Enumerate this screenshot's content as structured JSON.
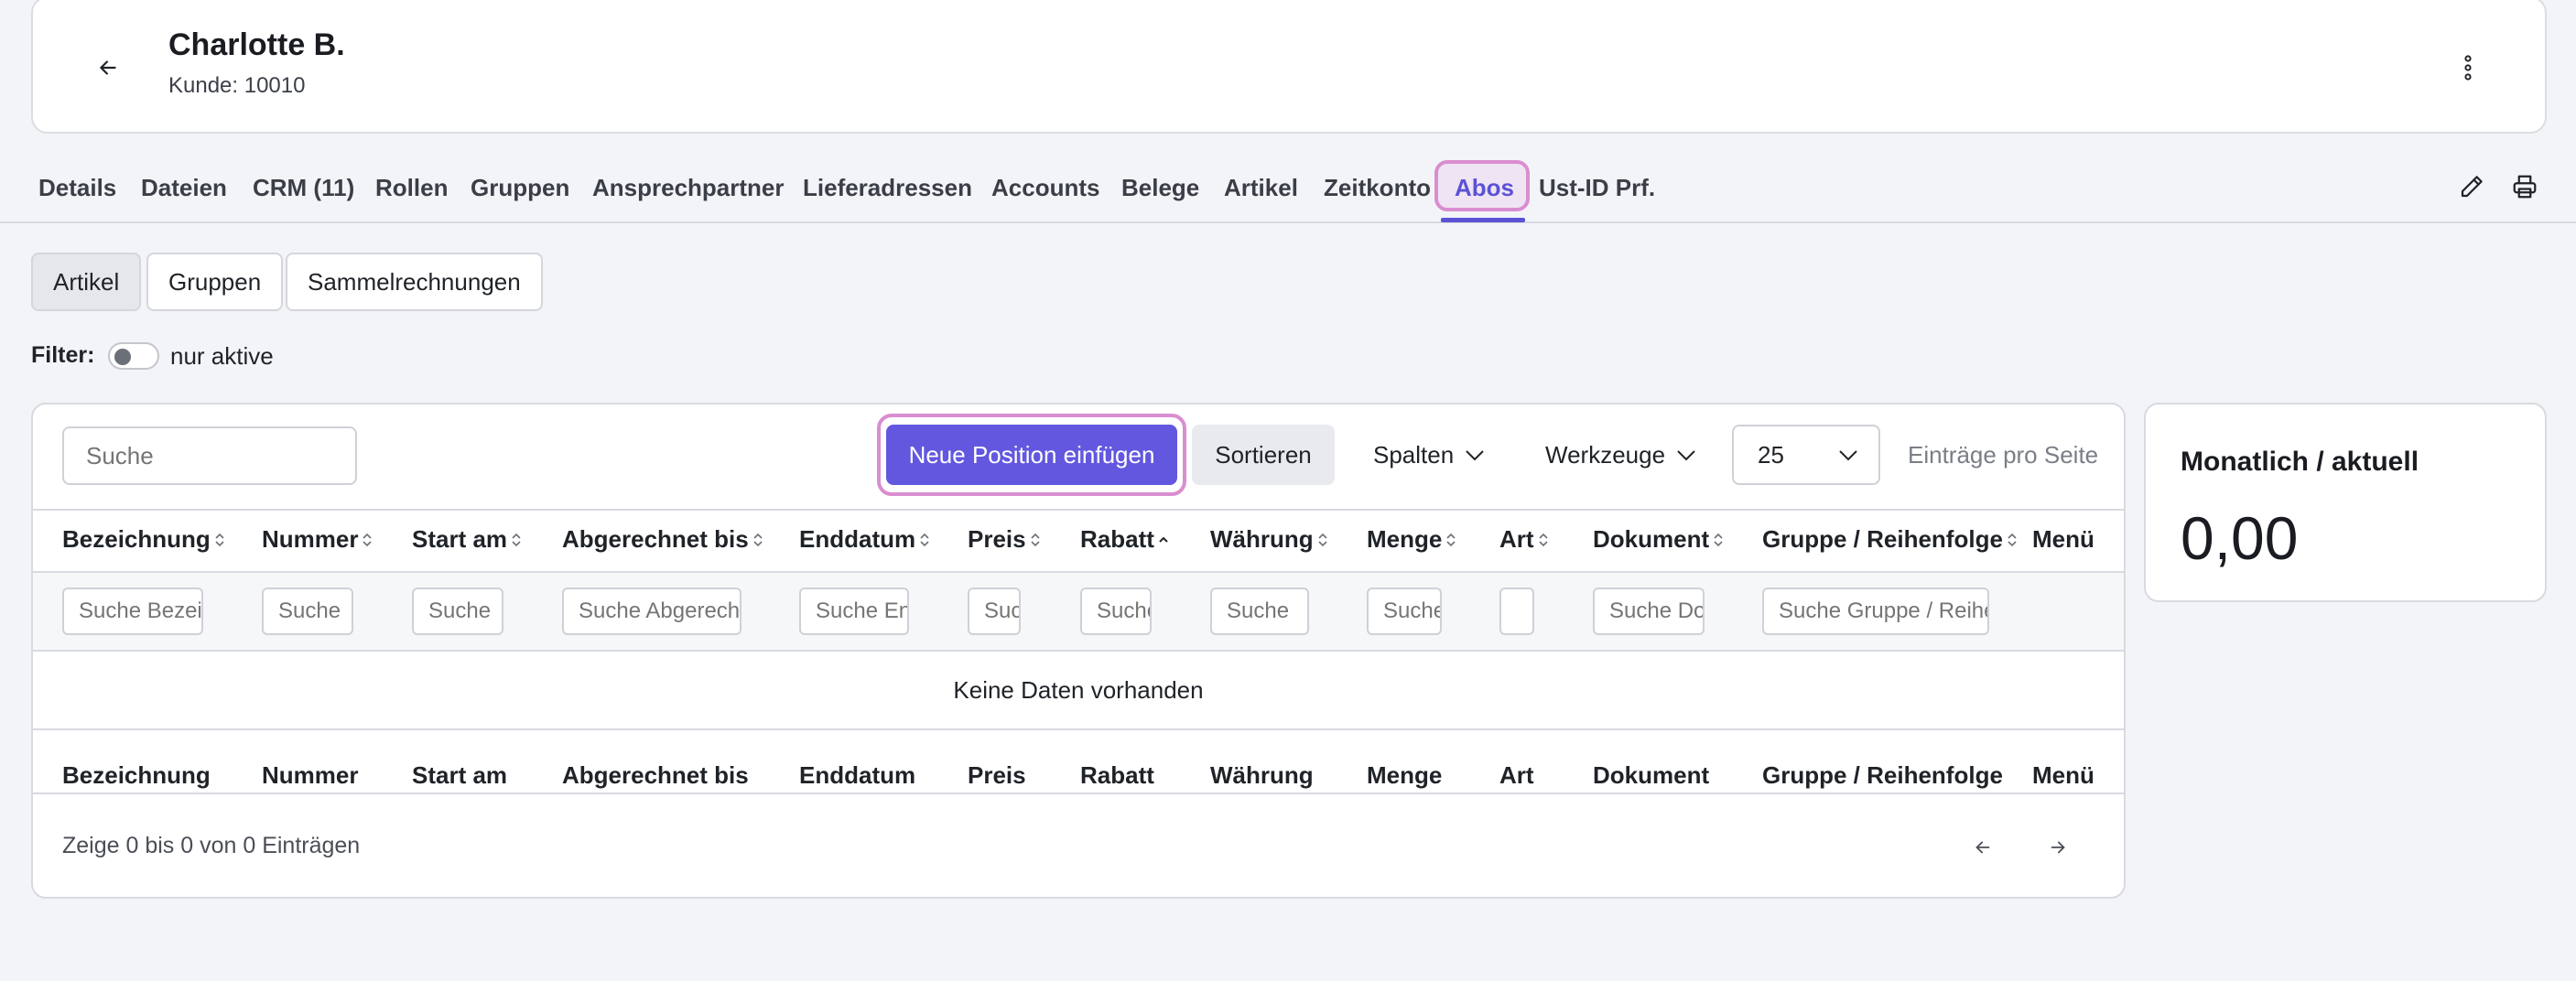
{
  "header": {
    "name": "Charlotte B.",
    "subtitle": "Kunde: 10010"
  },
  "tabs": [
    {
      "label": "Details"
    },
    {
      "label": "Dateien"
    },
    {
      "label": "CRM (11)"
    },
    {
      "label": "Rollen"
    },
    {
      "label": "Gruppen"
    },
    {
      "label": "Ansprechpartner"
    },
    {
      "label": "Lieferadressen"
    },
    {
      "label": "Accounts"
    },
    {
      "label": "Belege"
    },
    {
      "label": "Artikel"
    },
    {
      "label": "Zeitkonto"
    },
    {
      "label": "Abos",
      "active": true
    },
    {
      "label": "Ust-ID Prf."
    }
  ],
  "subtabs": [
    {
      "label": "Artikel",
      "active": true
    },
    {
      "label": "Gruppen"
    },
    {
      "label": "Sammelrechnungen"
    }
  ],
  "filter": {
    "label": "Filter",
    "colon": ":",
    "toggle_label": "nur aktive"
  },
  "toolbar": {
    "search_placeholder": "Suche",
    "new_position": "Neue Position einfügen",
    "sort": "Sortieren",
    "columns": "Spalten",
    "tools": "Werkzeuge",
    "page_size": "25",
    "per_page": "Einträge pro Seite"
  },
  "table": {
    "columns": [
      {
        "label": "Bezeichnung",
        "filter_placeholder": "Suche Bezeichnung"
      },
      {
        "label": "Nummer",
        "filter_placeholder": "Suche"
      },
      {
        "label": "Start am",
        "filter_placeholder": "Suche"
      },
      {
        "label": "Abgerechnet bis",
        "filter_placeholder": "Suche Abgerechnet bis"
      },
      {
        "label": "Enddatum",
        "filter_placeholder": "Suche Enddatum"
      },
      {
        "label": "Preis",
        "filter_placeholder": "Suche"
      },
      {
        "label": "Rabatt",
        "filter_placeholder": "Suche"
      },
      {
        "label": "Währung",
        "filter_placeholder": "Suche"
      },
      {
        "label": "Menge",
        "filter_placeholder": "Suche"
      },
      {
        "label": "Art",
        "filter_placeholder": ""
      },
      {
        "label": "Dokument",
        "filter_placeholder": "Suche Dokument"
      },
      {
        "label": "Gruppe / Reihenfolge",
        "filter_placeholder": "Suche Gruppe / Reihenfolge"
      },
      {
        "label": "Menü",
        "filter_placeholder": ""
      }
    ],
    "empty_text": "Keine Daten vorhanden",
    "info": "Zeige 0 bis 0 von 0 Einträgen"
  },
  "side_card": {
    "title": "Monatlich / aktuell",
    "value": "0,00"
  },
  "colors": {
    "accent": "#6357df",
    "highlight": "#d98ed0",
    "background": "#f3f4f8"
  },
  "icons": {
    "back": "arrow-left-icon",
    "menu": "kebab-menu-icon",
    "edit": "pencil-icon",
    "print": "printer-icon"
  }
}
